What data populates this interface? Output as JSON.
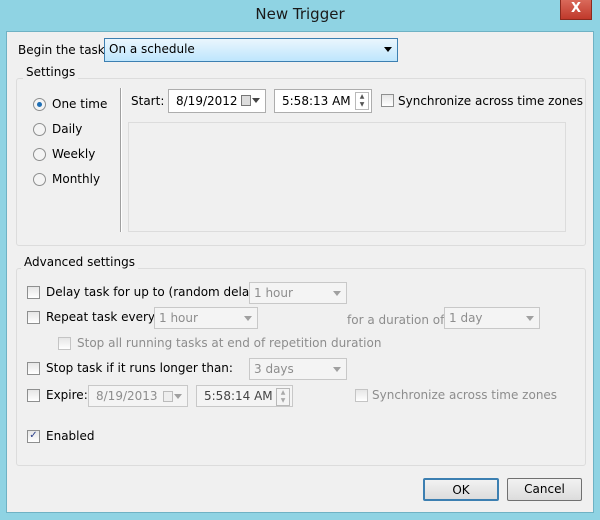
{
  "window": {
    "title": "New Trigger",
    "close_label": "X"
  },
  "begin": {
    "label": "Begin the task:",
    "value": "On a schedule"
  },
  "settings": {
    "label": "Settings",
    "options": [
      {
        "label": "One time",
        "selected": true
      },
      {
        "label": "Daily",
        "selected": false
      },
      {
        "label": "Weekly",
        "selected": false
      },
      {
        "label": "Monthly",
        "selected": false
      }
    ],
    "start_label": "Start:",
    "start_date": "8/19/2012",
    "start_time": "5:58:13 AM",
    "sync_label": "Synchronize across time zones"
  },
  "advanced": {
    "label": "Advanced settings",
    "delay_label": "Delay task for up to (random delay):",
    "delay_value": "1 hour",
    "repeat_label": "Repeat task every:",
    "repeat_value": "1 hour",
    "duration_label": "for a duration of:",
    "duration_value": "1 day",
    "stop_all_label": "Stop all running tasks at end of repetition duration",
    "stop_label": "Stop task if it runs longer than:",
    "stop_value": "3 days",
    "expire_label": "Expire:",
    "expire_date": "8/19/2013",
    "expire_time": "5:58:14 AM",
    "expire_sync_label": "Synchronize across time zones",
    "enabled_label": "Enabled",
    "enabled": true
  },
  "buttons": {
    "ok": "OK",
    "cancel": "Cancel"
  }
}
